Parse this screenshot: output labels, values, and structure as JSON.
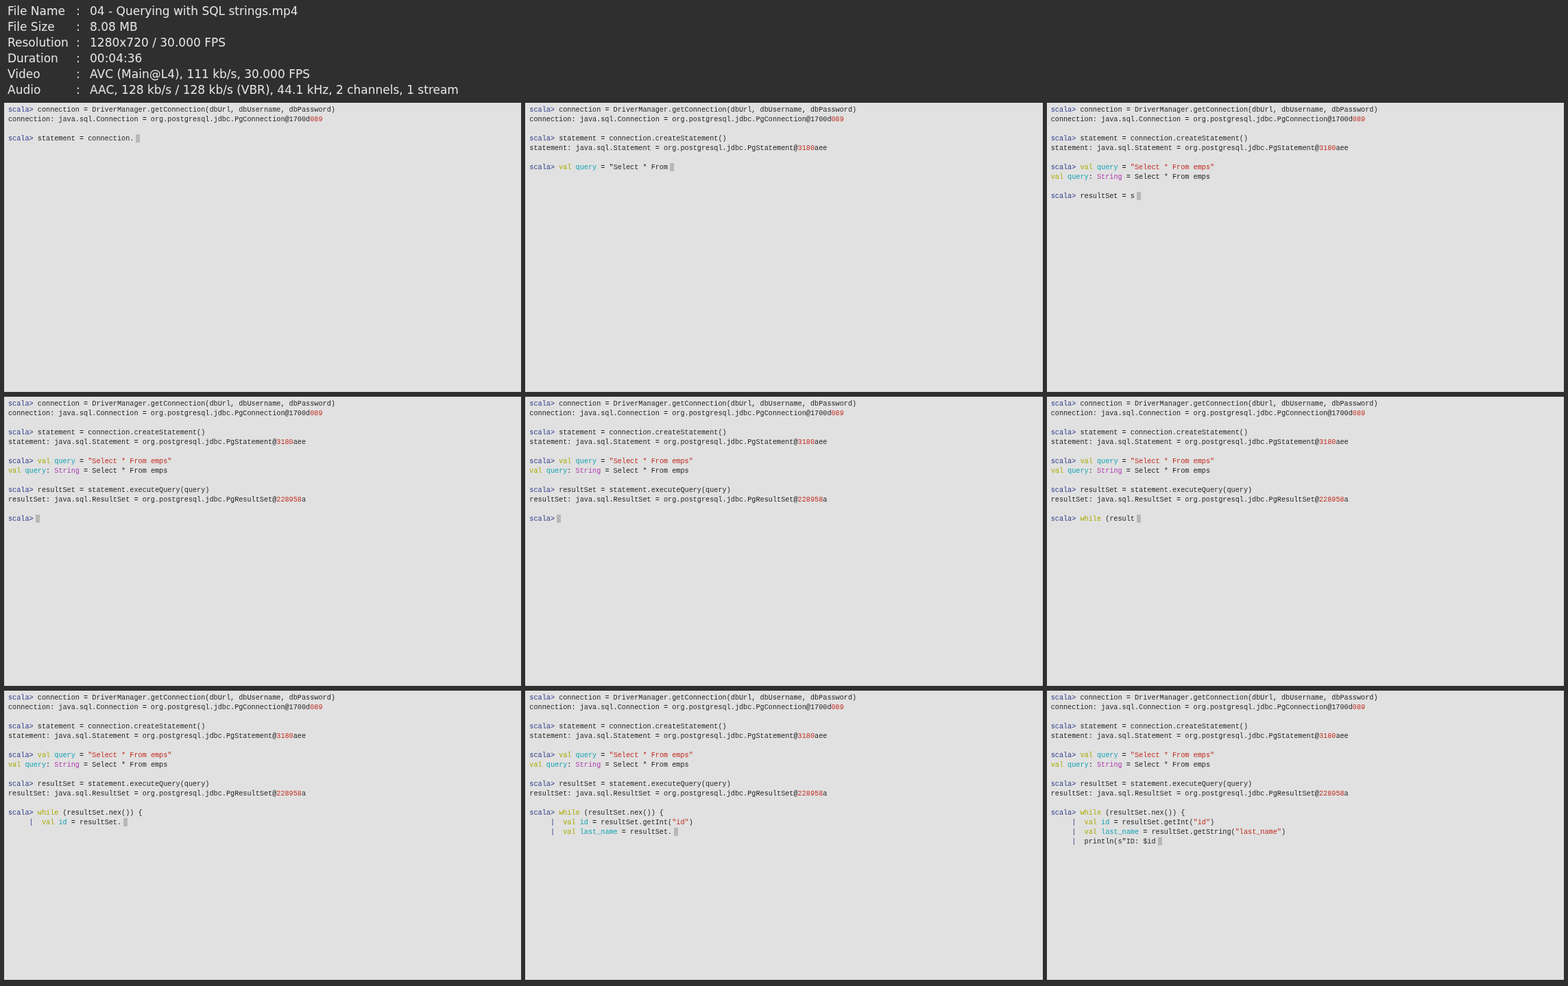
{
  "info": [
    {
      "label": "File Name",
      "separator": ":",
      "value": "04 - Querying with SQL strings.mp4"
    },
    {
      "label": "File Size",
      "separator": ":",
      "value": "8.08 MB"
    },
    {
      "label": "Resolution",
      "separator": ":",
      "value": "1280x720 / 30.000 FPS"
    },
    {
      "label": "Duration",
      "separator": ":",
      "value": "00:04:36"
    },
    {
      "label": "Video",
      "separator": ":",
      "value": "AVC (Main@L4), 111 kb/s, 30.000 FPS"
    },
    {
      "label": "Audio",
      "separator": ":",
      "value": "AAC, 128 kb/s / 128 kb/s (VBR), 44.1 kHz, 2 channels, 1 stream"
    }
  ],
  "frames": [
    {
      "blocks": [
        [
          {
            "segments": [
              {
                "text": "scala>",
                "kind": "prompt"
              },
              {
                "text": " connection = DriverManager.getConnection(dbUrl, dbUsername, dbPassword)",
                "kind": "plain"
              }
            ]
          },
          {
            "segments": [
              {
                "text": "connection: java.sql.Connection = org.postgresql.jdbc.PgConnection@1700d",
                "kind": "plain"
              },
              {
                "text": "089",
                "kind": "hex"
              }
            ]
          }
        ],
        [
          {
            "segments": [
              {
                "text": "scala>",
                "kind": "prompt"
              },
              {
                "text": " statement = connection.",
                "kind": "plain"
              }
            ],
            "cursor": true
          }
        ]
      ]
    },
    {
      "blocks": [
        [
          {
            "segments": [
              {
                "text": "scala>",
                "kind": "prompt"
              },
              {
                "text": " connection = DriverManager.getConnection(dbUrl, dbUsername, dbPassword)",
                "kind": "plain"
              }
            ]
          },
          {
            "segments": [
              {
                "text": "connection: java.sql.Connection = org.postgresql.jdbc.PgConnection@1700d",
                "kind": "plain"
              },
              {
                "text": "089",
                "kind": "hex"
              }
            ]
          }
        ],
        [
          {
            "segments": [
              {
                "text": "scala>",
                "kind": "prompt"
              },
              {
                "text": " statement = connection.createStatement()",
                "kind": "plain"
              }
            ]
          },
          {
            "segments": [
              {
                "text": "statement: java.sql.Statement = org.postgresql.jdbc.PgStatement@",
                "kind": "plain"
              },
              {
                "text": "3180",
                "kind": "hex"
              },
              {
                "text": "aee",
                "kind": "plain"
              }
            ]
          }
        ],
        [
          {
            "segments": [
              {
                "text": "scala>",
                "kind": "prompt"
              },
              {
                "text": " val",
                "kind": "keyword"
              },
              {
                "text": " query",
                "kind": "ident"
              },
              {
                "text": " = \"Select * From",
                "kind": "plain"
              }
            ],
            "cursor": true
          }
        ]
      ]
    },
    {
      "blocks": [
        [
          {
            "segments": [
              {
                "text": "scala>",
                "kind": "prompt"
              },
              {
                "text": " connection = DriverManager.getConnection(dbUrl, dbUsername, dbPassword)",
                "kind": "plain"
              }
            ]
          },
          {
            "segments": [
              {
                "text": "connection: java.sql.Connection = org.postgresql.jdbc.PgConnection@1700d",
                "kind": "plain"
              },
              {
                "text": "089",
                "kind": "hex"
              }
            ]
          }
        ],
        [
          {
            "segments": [
              {
                "text": "scala>",
                "kind": "prompt"
              },
              {
                "text": " statement = connection.createStatement()",
                "kind": "plain"
              }
            ]
          },
          {
            "segments": [
              {
                "text": "statement: java.sql.Statement = org.postgresql.jdbc.PgStatement@",
                "kind": "plain"
              },
              {
                "text": "3180",
                "kind": "hex"
              },
              {
                "text": "aee",
                "kind": "plain"
              }
            ]
          }
        ],
        [
          {
            "segments": [
              {
                "text": "scala>",
                "kind": "prompt"
              },
              {
                "text": " val",
                "kind": "keyword"
              },
              {
                "text": " query",
                "kind": "ident"
              },
              {
                "text": " = ",
                "kind": "plain"
              },
              {
                "text": "\"Select * From emps\"",
                "kind": "string"
              }
            ]
          },
          {
            "segments": [
              {
                "text": "val",
                "kind": "keyword"
              },
              {
                "text": " query",
                "kind": "ident"
              },
              {
                "text": ": ",
                "kind": "plain"
              },
              {
                "text": "String",
                "kind": "type"
              },
              {
                "text": " = Select * From emps",
                "kind": "plain"
              }
            ]
          }
        ],
        [
          {
            "segments": [
              {
                "text": "scala>",
                "kind": "prompt"
              },
              {
                "text": " resultSet = s",
                "kind": "plain"
              }
            ],
            "cursor": true
          }
        ]
      ]
    },
    {
      "blocks": [
        [
          {
            "segments": [
              {
                "text": "scala>",
                "kind": "prompt"
              },
              {
                "text": " connection = DriverManager.getConnection(dbUrl, dbUsername, dbPassword)",
                "kind": "plain"
              }
            ]
          },
          {
            "segments": [
              {
                "text": "connection: java.sql.Connection = org.postgresql.jdbc.PgConnection@1700d",
                "kind": "plain"
              },
              {
                "text": "089",
                "kind": "hex"
              }
            ]
          }
        ],
        [
          {
            "segments": [
              {
                "text": "scala>",
                "kind": "prompt"
              },
              {
                "text": " statement = connection.createStatement()",
                "kind": "plain"
              }
            ]
          },
          {
            "segments": [
              {
                "text": "statement: java.sql.Statement = org.postgresql.jdbc.PgStatement@",
                "kind": "plain"
              },
              {
                "text": "3180",
                "kind": "hex"
              },
              {
                "text": "aee",
                "kind": "plain"
              }
            ]
          }
        ],
        [
          {
            "segments": [
              {
                "text": "scala>",
                "kind": "prompt"
              },
              {
                "text": " val",
                "kind": "keyword"
              },
              {
                "text": " query",
                "kind": "ident"
              },
              {
                "text": " = ",
                "kind": "plain"
              },
              {
                "text": "\"Select * From emps\"",
                "kind": "string"
              }
            ]
          },
          {
            "segments": [
              {
                "text": "val",
                "kind": "keyword"
              },
              {
                "text": " query",
                "kind": "ident"
              },
              {
                "text": ": ",
                "kind": "plain"
              },
              {
                "text": "String",
                "kind": "type"
              },
              {
                "text": " = Select * From emps",
                "kind": "plain"
              }
            ]
          }
        ],
        [
          {
            "segments": [
              {
                "text": "scala>",
                "kind": "prompt"
              },
              {
                "text": " resultSet = statement.executeQuery(query)",
                "kind": "plain"
              }
            ]
          },
          {
            "segments": [
              {
                "text": "resultSet: java.sql.ResultSet = org.postgresql.jdbc.PgResultSet@",
                "kind": "plain"
              },
              {
                "text": "228958",
                "kind": "hex"
              },
              {
                "text": "a",
                "kind": "plain"
              }
            ]
          }
        ],
        [
          {
            "segments": [
              {
                "text": "scala>",
                "kind": "prompt"
              }
            ],
            "cursor": true
          }
        ]
      ]
    },
    {
      "blocks": [
        [
          {
            "segments": [
              {
                "text": "scala>",
                "kind": "prompt"
              },
              {
                "text": " connection = DriverManager.getConnection(dbUrl, dbUsername, dbPassword)",
                "kind": "plain"
              }
            ]
          },
          {
            "segments": [
              {
                "text": "connection: java.sql.Connection = org.postgresql.jdbc.PgConnection@1700d",
                "kind": "plain"
              },
              {
                "text": "089",
                "kind": "hex"
              }
            ]
          }
        ],
        [
          {
            "segments": [
              {
                "text": "scala>",
                "kind": "prompt"
              },
              {
                "text": " statement = connection.createStatement()",
                "kind": "plain"
              }
            ]
          },
          {
            "segments": [
              {
                "text": "statement: java.sql.Statement = org.postgresql.jdbc.PgStatement@",
                "kind": "plain"
              },
              {
                "text": "3180",
                "kind": "hex"
              },
              {
                "text": "aee",
                "kind": "plain"
              }
            ]
          }
        ],
        [
          {
            "segments": [
              {
                "text": "scala>",
                "kind": "prompt"
              },
              {
                "text": " val",
                "kind": "keyword"
              },
              {
                "text": " query",
                "kind": "ident"
              },
              {
                "text": " = ",
                "kind": "plain"
              },
              {
                "text": "\"Select * From emps\"",
                "kind": "string"
              }
            ]
          },
          {
            "segments": [
              {
                "text": "val",
                "kind": "keyword"
              },
              {
                "text": " query",
                "kind": "ident"
              },
              {
                "text": ": ",
                "kind": "plain"
              },
              {
                "text": "String",
                "kind": "type"
              },
              {
                "text": " = Select * From emps",
                "kind": "plain"
              }
            ]
          }
        ],
        [
          {
            "segments": [
              {
                "text": "scala>",
                "kind": "prompt"
              },
              {
                "text": " resultSet = statement.executeQuery(query)",
                "kind": "plain"
              }
            ]
          },
          {
            "segments": [
              {
                "text": "resultSet: java.sql.ResultSet = org.postgresql.jdbc.PgResultSet@",
                "kind": "plain"
              },
              {
                "text": "228958",
                "kind": "hex"
              },
              {
                "text": "a",
                "kind": "plain"
              }
            ]
          }
        ],
        [
          {
            "segments": [
              {
                "text": "scala>",
                "kind": "prompt"
              }
            ],
            "cursor": true
          }
        ]
      ]
    },
    {
      "blocks": [
        [
          {
            "segments": [
              {
                "text": "scala>",
                "kind": "prompt"
              },
              {
                "text": " connection = DriverManager.getConnection(dbUrl, dbUsername, dbPassword)",
                "kind": "plain"
              }
            ]
          },
          {
            "segments": [
              {
                "text": "connection: java.sql.Connection = org.postgresql.jdbc.PgConnection@1700d",
                "kind": "plain"
              },
              {
                "text": "089",
                "kind": "hex"
              }
            ]
          }
        ],
        [
          {
            "segments": [
              {
                "text": "scala>",
                "kind": "prompt"
              },
              {
                "text": " statement = connection.createStatement()",
                "kind": "plain"
              }
            ]
          },
          {
            "segments": [
              {
                "text": "statement: java.sql.Statement = org.postgresql.jdbc.PgStatement@",
                "kind": "plain"
              },
              {
                "text": "3180",
                "kind": "hex"
              },
              {
                "text": "aee",
                "kind": "plain"
              }
            ]
          }
        ],
        [
          {
            "segments": [
              {
                "text": "scala>",
                "kind": "prompt"
              },
              {
                "text": " val",
                "kind": "keyword"
              },
              {
                "text": " query",
                "kind": "ident"
              },
              {
                "text": " = ",
                "kind": "plain"
              },
              {
                "text": "\"Select * From emps\"",
                "kind": "string"
              }
            ]
          },
          {
            "segments": [
              {
                "text": "val",
                "kind": "keyword"
              },
              {
                "text": " query",
                "kind": "ident"
              },
              {
                "text": ": ",
                "kind": "plain"
              },
              {
                "text": "String",
                "kind": "type"
              },
              {
                "text": " = Select * From emps",
                "kind": "plain"
              }
            ]
          }
        ],
        [
          {
            "segments": [
              {
                "text": "scala>",
                "kind": "prompt"
              },
              {
                "text": " resultSet = statement.executeQuery(query)",
                "kind": "plain"
              }
            ]
          },
          {
            "segments": [
              {
                "text": "resultSet: java.sql.ResultSet = org.postgresql.jdbc.PgResultSet@",
                "kind": "plain"
              },
              {
                "text": "228958",
                "kind": "hex"
              },
              {
                "text": "a",
                "kind": "plain"
              }
            ]
          }
        ],
        [
          {
            "segments": [
              {
                "text": "scala>",
                "kind": "prompt"
              },
              {
                "text": " while",
                "kind": "keyword"
              },
              {
                "text": " (result",
                "kind": "plain"
              }
            ],
            "cursor": true
          }
        ]
      ]
    },
    {
      "blocks": [
        [
          {
            "segments": [
              {
                "text": "scala>",
                "kind": "prompt"
              },
              {
                "text": " connection = DriverManager.getConnection(dbUrl, dbUsername, dbPassword)",
                "kind": "plain"
              }
            ]
          },
          {
            "segments": [
              {
                "text": "connection: java.sql.Connection = org.postgresql.jdbc.PgConnection@1700d",
                "kind": "plain"
              },
              {
                "text": "089",
                "kind": "hex"
              }
            ]
          }
        ],
        [
          {
            "segments": [
              {
                "text": "scala>",
                "kind": "prompt"
              },
              {
                "text": " statement = connection.createStatement()",
                "kind": "plain"
              }
            ]
          },
          {
            "segments": [
              {
                "text": "statement: java.sql.Statement = org.postgresql.jdbc.PgStatement@",
                "kind": "plain"
              },
              {
                "text": "3180",
                "kind": "hex"
              },
              {
                "text": "aee",
                "kind": "plain"
              }
            ]
          }
        ],
        [
          {
            "segments": [
              {
                "text": "scala>",
                "kind": "prompt"
              },
              {
                "text": " val",
                "kind": "keyword"
              },
              {
                "text": " query",
                "kind": "ident"
              },
              {
                "text": " = ",
                "kind": "plain"
              },
              {
                "text": "\"Select * From emps\"",
                "kind": "string"
              }
            ]
          },
          {
            "segments": [
              {
                "text": "val",
                "kind": "keyword"
              },
              {
                "text": " query",
                "kind": "ident"
              },
              {
                "text": ": ",
                "kind": "plain"
              },
              {
                "text": "String",
                "kind": "type"
              },
              {
                "text": " = Select * From emps",
                "kind": "plain"
              }
            ]
          }
        ],
        [
          {
            "segments": [
              {
                "text": "scala>",
                "kind": "prompt"
              },
              {
                "text": " resultSet = statement.executeQuery(query)",
                "kind": "plain"
              }
            ]
          },
          {
            "segments": [
              {
                "text": "resultSet: java.sql.ResultSet = org.postgresql.jdbc.PgResultSet@",
                "kind": "plain"
              },
              {
                "text": "228958",
                "kind": "hex"
              },
              {
                "text": "a",
                "kind": "plain"
              }
            ]
          }
        ],
        [
          {
            "segments": [
              {
                "text": "scala>",
                "kind": "prompt"
              },
              {
                "text": " while",
                "kind": "keyword"
              },
              {
                "text": " (resultSet.nex()) {",
                "kind": "plain"
              }
            ]
          },
          {
            "segments": [
              {
                "text": "     |",
                "kind": "pipe"
              },
              {
                "text": "  val",
                "kind": "keyword"
              },
              {
                "text": " id",
                "kind": "ident"
              },
              {
                "text": " = resultSet.",
                "kind": "plain"
              }
            ],
            "cursor": true
          }
        ]
      ]
    },
    {
      "blocks": [
        [
          {
            "segments": [
              {
                "text": "scala>",
                "kind": "prompt"
              },
              {
                "text": " connection = DriverManager.getConnection(dbUrl, dbUsername, dbPassword)",
                "kind": "plain"
              }
            ]
          },
          {
            "segments": [
              {
                "text": "connection: java.sql.Connection = org.postgresql.jdbc.PgConnection@1700d",
                "kind": "plain"
              },
              {
                "text": "089",
                "kind": "hex"
              }
            ]
          }
        ],
        [
          {
            "segments": [
              {
                "text": "scala>",
                "kind": "prompt"
              },
              {
                "text": " statement = connection.createStatement()",
                "kind": "plain"
              }
            ]
          },
          {
            "segments": [
              {
                "text": "statement: java.sql.Statement = org.postgresql.jdbc.PgStatement@",
                "kind": "plain"
              },
              {
                "text": "3180",
                "kind": "hex"
              },
              {
                "text": "aee",
                "kind": "plain"
              }
            ]
          }
        ],
        [
          {
            "segments": [
              {
                "text": "scala>",
                "kind": "prompt"
              },
              {
                "text": " val",
                "kind": "keyword"
              },
              {
                "text": " query",
                "kind": "ident"
              },
              {
                "text": " = ",
                "kind": "plain"
              },
              {
                "text": "\"Select * From emps\"",
                "kind": "string"
              }
            ]
          },
          {
            "segments": [
              {
                "text": "val",
                "kind": "keyword"
              },
              {
                "text": " query",
                "kind": "ident"
              },
              {
                "text": ": ",
                "kind": "plain"
              },
              {
                "text": "String",
                "kind": "type"
              },
              {
                "text": " = Select * From emps",
                "kind": "plain"
              }
            ]
          }
        ],
        [
          {
            "segments": [
              {
                "text": "scala>",
                "kind": "prompt"
              },
              {
                "text": " resultSet = statement.executeQuery(query)",
                "kind": "plain"
              }
            ]
          },
          {
            "segments": [
              {
                "text": "resultSet: java.sql.ResultSet = org.postgresql.jdbc.PgResultSet@",
                "kind": "plain"
              },
              {
                "text": "228958",
                "kind": "hex"
              },
              {
                "text": "a",
                "kind": "plain"
              }
            ]
          }
        ],
        [
          {
            "segments": [
              {
                "text": "scala>",
                "kind": "prompt"
              },
              {
                "text": " while",
                "kind": "keyword"
              },
              {
                "text": " (resultSet.nex()) {",
                "kind": "plain"
              }
            ]
          },
          {
            "segments": [
              {
                "text": "     |",
                "kind": "pipe"
              },
              {
                "text": "  val",
                "kind": "keyword"
              },
              {
                "text": " id",
                "kind": "ident"
              },
              {
                "text": " = resultSet.getInt(",
                "kind": "plain"
              },
              {
                "text": "\"id\"",
                "kind": "string"
              },
              {
                "text": ")",
                "kind": "plain"
              }
            ]
          },
          {
            "segments": [
              {
                "text": "     |",
                "kind": "pipe"
              },
              {
                "text": "  val",
                "kind": "keyword"
              },
              {
                "text": " last_name",
                "kind": "ident"
              },
              {
                "text": " = resultSet.",
                "kind": "plain"
              }
            ],
            "cursor": true
          }
        ]
      ]
    },
    {
      "blocks": [
        [
          {
            "segments": [
              {
                "text": "scala>",
                "kind": "prompt"
              },
              {
                "text": " connection = DriverManager.getConnection(dbUrl, dbUsername, dbPassword)",
                "kind": "plain"
              }
            ]
          },
          {
            "segments": [
              {
                "text": "connection: java.sql.Connection = org.postgresql.jdbc.PgConnection@1700d",
                "kind": "plain"
              },
              {
                "text": "089",
                "kind": "hex"
              }
            ]
          }
        ],
        [
          {
            "segments": [
              {
                "text": "scala>",
                "kind": "prompt"
              },
              {
                "text": " statement = connection.createStatement()",
                "kind": "plain"
              }
            ]
          },
          {
            "segments": [
              {
                "text": "statement: java.sql.Statement = org.postgresql.jdbc.PgStatement@",
                "kind": "plain"
              },
              {
                "text": "3180",
                "kind": "hex"
              },
              {
                "text": "aee",
                "kind": "plain"
              }
            ]
          }
        ],
        [
          {
            "segments": [
              {
                "text": "scala>",
                "kind": "prompt"
              },
              {
                "text": " val",
                "kind": "keyword"
              },
              {
                "text": " query",
                "kind": "ident"
              },
              {
                "text": " = ",
                "kind": "plain"
              },
              {
                "text": "\"Select * From emps\"",
                "kind": "string"
              }
            ]
          },
          {
            "segments": [
              {
                "text": "val",
                "kind": "keyword"
              },
              {
                "text": " query",
                "kind": "ident"
              },
              {
                "text": ": ",
                "kind": "plain"
              },
              {
                "text": "String",
                "kind": "type"
              },
              {
                "text": " = Select * From emps",
                "kind": "plain"
              }
            ]
          }
        ],
        [
          {
            "segments": [
              {
                "text": "scala>",
                "kind": "prompt"
              },
              {
                "text": " resultSet = statement.executeQuery(query)",
                "kind": "plain"
              }
            ]
          },
          {
            "segments": [
              {
                "text": "resultSet: java.sql.ResultSet = org.postgresql.jdbc.PgResultSet@",
                "kind": "plain"
              },
              {
                "text": "228958",
                "kind": "hex"
              },
              {
                "text": "a",
                "kind": "plain"
              }
            ]
          }
        ],
        [
          {
            "segments": [
              {
                "text": "scala>",
                "kind": "prompt"
              },
              {
                "text": " while",
                "kind": "keyword"
              },
              {
                "text": " (resultSet.nex()) {",
                "kind": "plain"
              }
            ]
          },
          {
            "segments": [
              {
                "text": "     |",
                "kind": "pipe"
              },
              {
                "text": "  val",
                "kind": "keyword"
              },
              {
                "text": " id",
                "kind": "ident"
              },
              {
                "text": " = resultSet.getInt(",
                "kind": "plain"
              },
              {
                "text": "\"id\"",
                "kind": "string"
              },
              {
                "text": ")",
                "kind": "plain"
              }
            ]
          },
          {
            "segments": [
              {
                "text": "     |",
                "kind": "pipe"
              },
              {
                "text": "  val",
                "kind": "keyword"
              },
              {
                "text": " last_name",
                "kind": "ident"
              },
              {
                "text": " = resultSet.getString(",
                "kind": "plain"
              },
              {
                "text": "\"last_name\"",
                "kind": "string"
              },
              {
                "text": ")",
                "kind": "plain"
              }
            ]
          },
          {
            "segments": [
              {
                "text": "     |",
                "kind": "pipe"
              },
              {
                "text": "  println(s\"ID: $id",
                "kind": "plain"
              }
            ],
            "cursor": true
          }
        ]
      ]
    }
  ]
}
